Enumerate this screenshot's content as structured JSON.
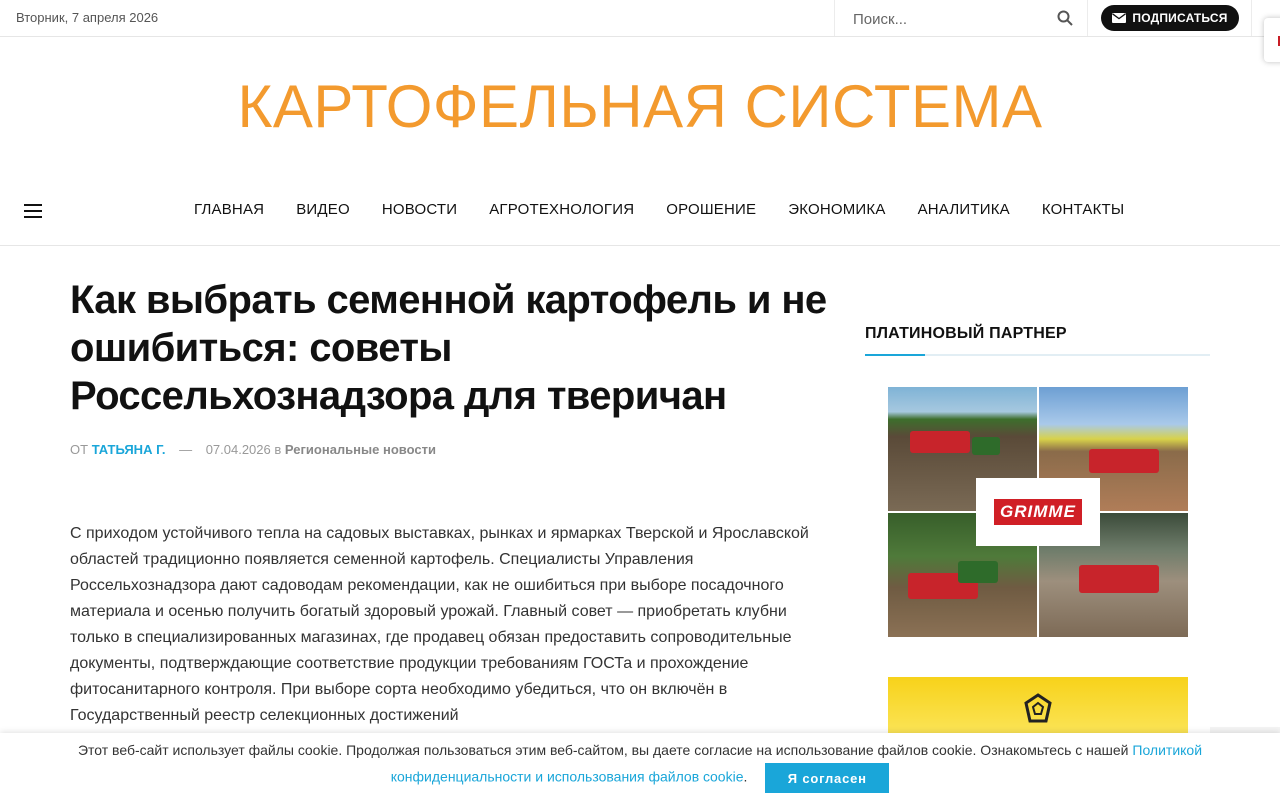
{
  "topbar": {
    "date": "Вторник, 7 апреля 2026",
    "search_placeholder": "Поиск...",
    "subscribe_label": "ПОДПИСАТЬСЯ"
  },
  "site": {
    "logo": "КАРТОФЕЛЬНАЯ СИСТЕМА",
    "logo_color": "#f39a2e"
  },
  "nav": {
    "items": [
      {
        "label": "ГЛАВНАЯ"
      },
      {
        "label": "ВИДЕО"
      },
      {
        "label": "НОВОСТИ"
      },
      {
        "label": "АГРОТЕХНОЛОГИЯ"
      },
      {
        "label": "ОРОШЕНИЕ"
      },
      {
        "label": "ЭКОНОМИКА"
      },
      {
        "label": "АНАЛИТИКА"
      },
      {
        "label": "КОНТАКТЫ"
      }
    ]
  },
  "article": {
    "title": "Как выбрать семенной картофель и не ошибиться: советы Россельхознадзора для тверичан",
    "by": "ОТ",
    "author": "ТАТЬЯНА Г.",
    "dash": "—",
    "date": "07.04.2026",
    "in": "в",
    "category": "Региональные новости",
    "body": "С приходом устойчивого тепла на садовых выставках, рынках и ярмарках Тверской и Ярославской областей традиционно появляется семенной картофель. Специалисты Управления Россельхознадзора дают садоводам рекомендации, как не ошибиться при выборе посадочного материала и осенью получить богатый здоровый урожай. Главный совет — приобретать клубни только в специализированных магазинах, где продавец обязан предоставить сопроводительные документы, подтверждающие соответствие продукции требованиям ГОСТа и прохождение фитосанитарного контроля. При выборе сорта необходимо убедиться, что он включён в Государственный реестр селекционных достижений"
  },
  "sidebar": {
    "title": "ПЛАТИНОВЫЙ ПАРТНЕР",
    "accent_color": "#1aa6d9",
    "ad_brand": "GRIMME"
  },
  "cookie": {
    "text": "Этот веб-сайт использует файлы cookie. Продолжая пользоваться этим веб-сайтом, вы даете согласие на использование файлов cookie. Ознакомьтесь с нашей ",
    "link": "Политикой конфиденциальности и использования файлов cookie",
    "after_link": ".",
    "agree_label": "Я согласен"
  }
}
